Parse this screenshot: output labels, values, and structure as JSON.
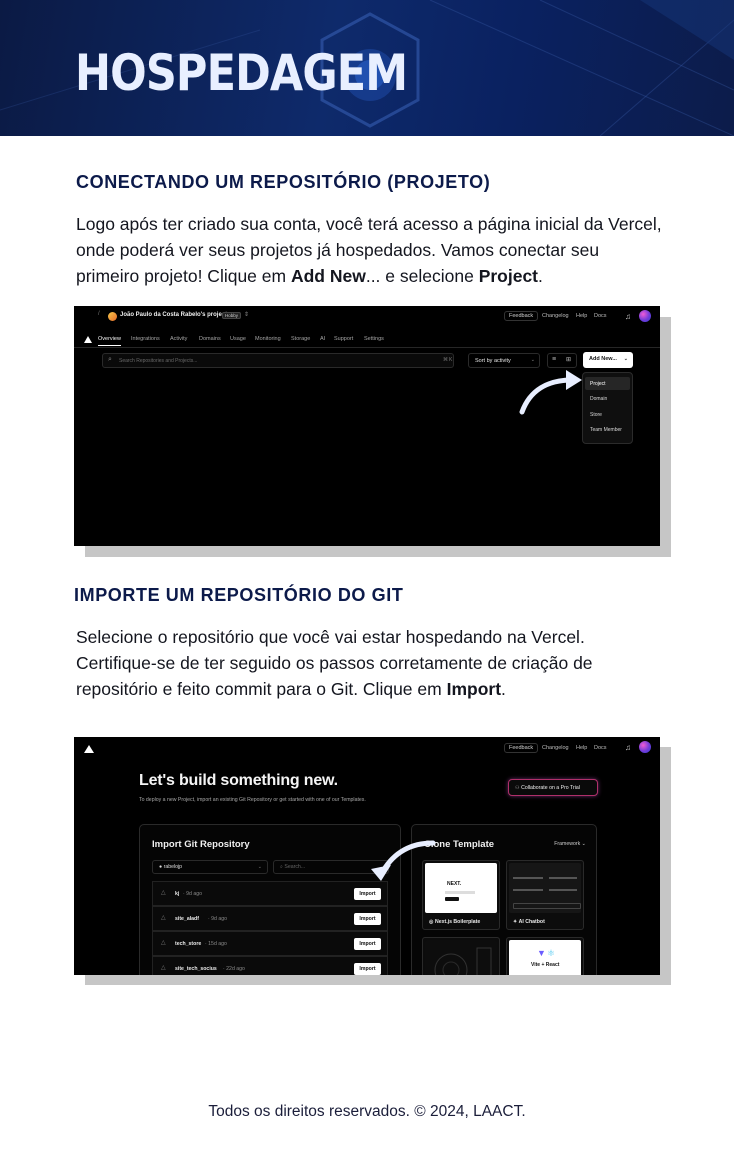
{
  "banner": {
    "title": "HOSPEDAGEM"
  },
  "section1": {
    "heading": "CONECTANDO UM REPOSITÓRIO (PROJETO)",
    "line1": "Logo após ter criado sua conta, você terá acesso a página inicial da Vercel,",
    "line2": "onde poderá ver seus projetos já hospedados. Vamos conectar seu",
    "line3_a": "primeiro projeto! Clique em ",
    "line3_b": "Add New",
    "line3_c": "... e selecione ",
    "line3_d": "Project",
    "line3_e": "."
  },
  "shot1": {
    "team_name": "João Paulo da Costa Rabelo's projects",
    "plan_badge": "Hobby",
    "top_links": [
      "Feedback",
      "Changelog",
      "Help",
      "Docs"
    ],
    "tabs": [
      "Overview",
      "Integrations",
      "Activity",
      "Domains",
      "Usage",
      "Monitoring",
      "Storage",
      "AI",
      "Support",
      "Settings"
    ],
    "search_placeholder": "Search Repositories and Projects...",
    "search_kbd": [
      "⌘",
      "K"
    ],
    "sort_label": "Sort by activity",
    "add_new_label": "Add New...",
    "menu_items": [
      "Project",
      "Domain",
      "Store",
      "Team Member"
    ]
  },
  "section2": {
    "heading": "IMPORTE UM REPOSITÓRIO DO GIT",
    "line1": "Selecione o repositório que você vai estar hospedando na Vercel.",
    "line2": "Certifique-se de ter seguido os passos corretamente de criação de",
    "line3_a": "repositório e feito commit para o Git. Clique em ",
    "line3_b": "Import",
    "line3_c": "."
  },
  "shot2": {
    "top_links": [
      "Feedback",
      "Changelog",
      "Help",
      "Docs"
    ],
    "headline": "Let's build something new.",
    "subtitle": "To deploy a new Project, import an existing Git Repository or get started with one of our Templates.",
    "collab_button": "Collaborate on a Pro Trial",
    "import_title": "Import Git Repository",
    "owner": "rabelojp",
    "search_placeholder": "Search...",
    "repos": [
      {
        "name": "kj",
        "age": "· 9d ago"
      },
      {
        "name": "site_aladf",
        "age": "· 9d ago"
      },
      {
        "name": "tech_store",
        "age": "· 15d ago"
      },
      {
        "name": "site_tech_socius",
        "age": "· 22d ago"
      }
    ],
    "import_label": "Import",
    "clone_title": "Clone Template",
    "framework_label": "Framework",
    "templates": [
      "Next.js Boilerplate",
      "AI Chatbot",
      "",
      "Vite + React"
    ]
  },
  "footer": {
    "text": "Todos os direitos reservados. © 2024, LAACT."
  }
}
